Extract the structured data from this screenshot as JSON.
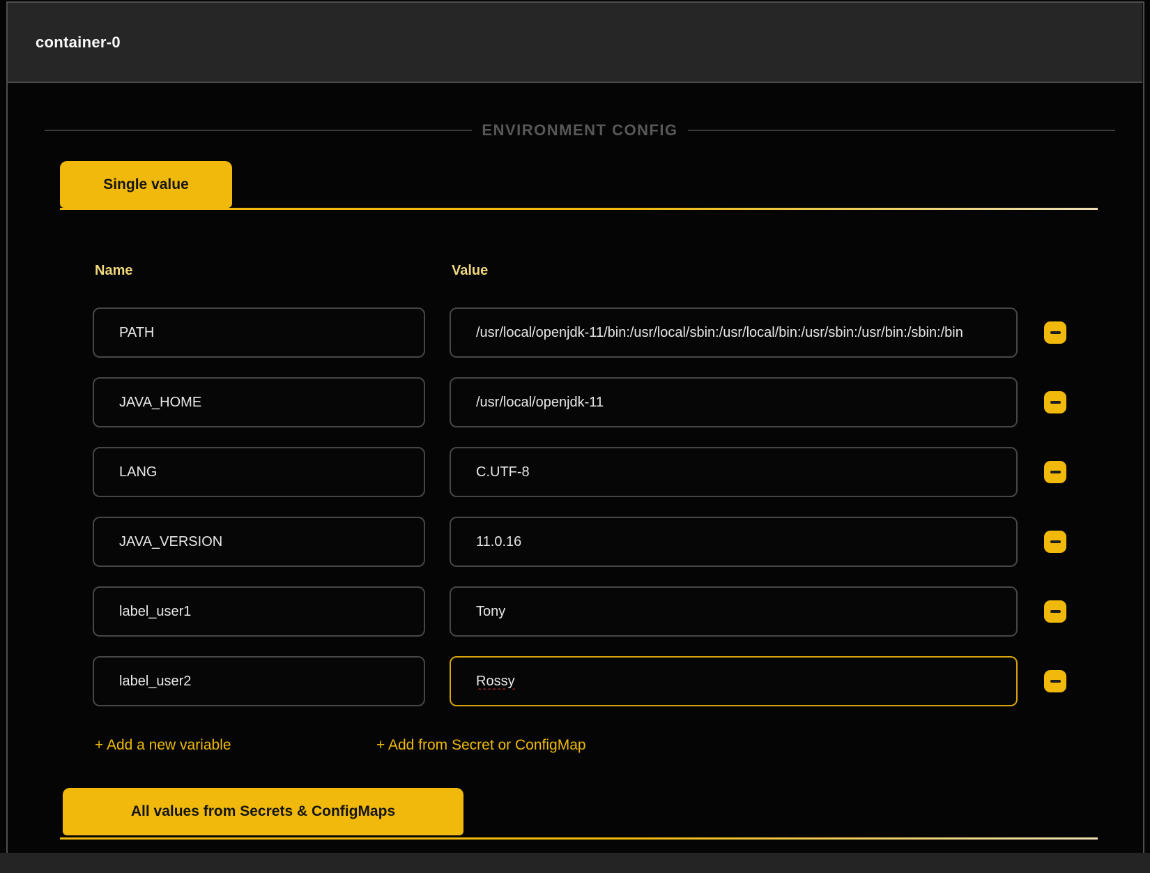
{
  "window": {
    "title": "container-0"
  },
  "section": {
    "legend": "ENVIRONMENT CONFIG"
  },
  "tabs": {
    "single_value_label": "Single value",
    "all_values_label": "All values from Secrets & ConfigMaps"
  },
  "columns": {
    "name": "Name",
    "value": "Value"
  },
  "env_vars": [
    {
      "name": "PATH",
      "value": "/usr/local/openjdk-11/bin:/usr/local/sbin:/usr/local/bin:/usr/sbin:/usr/bin:/sbin:/bin",
      "focused": false,
      "misspelled": false
    },
    {
      "name": "JAVA_HOME",
      "value": "/usr/local/openjdk-11",
      "focused": false,
      "misspelled": false
    },
    {
      "name": "LANG",
      "value": "C.UTF-8",
      "focused": false,
      "misspelled": false
    },
    {
      "name": "JAVA_VERSION",
      "value": "11.0.16",
      "focused": false,
      "misspelled": false
    },
    {
      "name": "label_user1",
      "value": "Tony",
      "focused": false,
      "misspelled": false
    },
    {
      "name": "label_user2",
      "value": "Rossy",
      "focused": true,
      "misspelled": true
    }
  ],
  "actions": {
    "add_variable_label": "+ Add a new variable",
    "add_from_secret_label": "+ Add from Secret or ConfigMap"
  },
  "icons": {
    "remove_row": "minus-icon"
  },
  "colors": {
    "accent": "#f0b90b",
    "header_bg": "#262626",
    "body_bg": "#050505",
    "field_border": "#474747",
    "focused_border": "#d9a50d",
    "label_text": "#f1d77e",
    "legend_text": "#585858",
    "spellcheck_underline": "#cc2b2b"
  }
}
